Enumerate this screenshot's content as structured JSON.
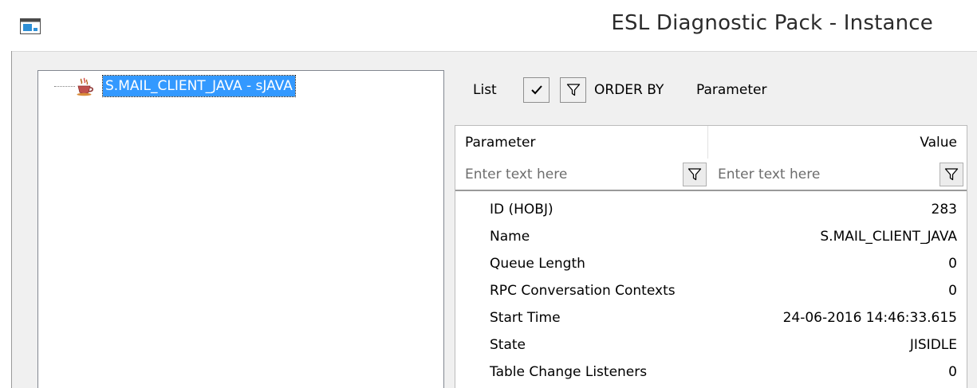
{
  "window": {
    "title": "ESL Diagnostic Pack - Instance",
    "icon": "application-window-icon"
  },
  "tree": {
    "nodes": [
      {
        "label": "S.MAIL_CLIENT_JAVA - sJAVA",
        "icon": "java-coffee-cup-icon",
        "selected": true
      }
    ]
  },
  "toolbar": {
    "list_label": "List",
    "check_icon": "checkmark-icon",
    "filter_icon": "funnel-filter-icon",
    "order_by_label": "ORDER BY",
    "order_by_value": "Parameter"
  },
  "grid": {
    "columns": [
      {
        "key": "parameter",
        "label": "Parameter"
      },
      {
        "key": "value",
        "label": "Value"
      }
    ],
    "filters": {
      "parameter_placeholder": "Enter text here",
      "value_placeholder": "Enter text here"
    },
    "rows": [
      {
        "parameter": "ID (HOBJ)",
        "value": "283"
      },
      {
        "parameter": "Name",
        "value": "S.MAIL_CLIENT_JAVA"
      },
      {
        "parameter": "Queue Length",
        "value": "0"
      },
      {
        "parameter": "RPC Conversation Contexts",
        "value": "0"
      },
      {
        "parameter": "Start Time",
        "value": "24-06-2016 14:46:33.615"
      },
      {
        "parameter": "State",
        "value": "JISIDLE"
      },
      {
        "parameter": "Table Change Listeners",
        "value": "0"
      }
    ]
  },
  "colors": {
    "selection": "#3399ff",
    "panel_background": "#f0f0f0",
    "border": "#828790"
  }
}
